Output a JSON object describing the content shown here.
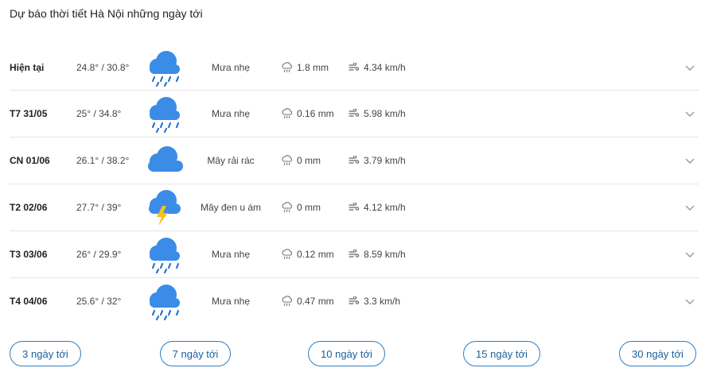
{
  "page_title": "Dự báo thời tiết Hà Nội những ngày tới",
  "rows": [
    {
      "day": "Hiện tại",
      "temp": "24.8° / 30.8°",
      "icon": "rain-cloud-icon",
      "desc": "Mưa nhẹ",
      "rain": "1.8 mm",
      "wind": "4.34 km/h"
    },
    {
      "day": "T7 31/05",
      "temp": "25° / 34.8°",
      "icon": "rain-cloud-icon",
      "desc": "Mưa nhẹ",
      "rain": "0.16 mm",
      "wind": "5.98 km/h"
    },
    {
      "day": "CN 01/06",
      "temp": "26.1° / 38.2°",
      "icon": "cloud-icon",
      "desc": "Mây rải rác",
      "rain": "0 mm",
      "wind": "3.79 km/h"
    },
    {
      "day": "T2 02/06",
      "temp": "27.7° / 39°",
      "icon": "thunderstorm-cloud-icon",
      "desc": "Mây đen u ám",
      "rain": "0 mm",
      "wind": "4.12 km/h"
    },
    {
      "day": "T3 03/06",
      "temp": "26° / 29.9°",
      "icon": "rain-cloud-icon",
      "desc": "Mưa nhẹ",
      "rain": "0.12 mm",
      "wind": "8.59 km/h"
    },
    {
      "day": "T4 04/06",
      "temp": "25.6° / 32°",
      "icon": "rain-cloud-icon",
      "desc": "Mưa nhẹ",
      "rain": "0.47 mm",
      "wind": "3.3 km/h"
    }
  ],
  "buttons": [
    "3 ngày tới",
    "7 ngày tới",
    "10 ngày tới",
    "15 ngày tới",
    "30 ngày tới"
  ],
  "colors": {
    "accent": "#2f7ec3",
    "cloud": "#3b8ce6",
    "rain": "#2f73c9",
    "bolt": "#f6c21a"
  }
}
